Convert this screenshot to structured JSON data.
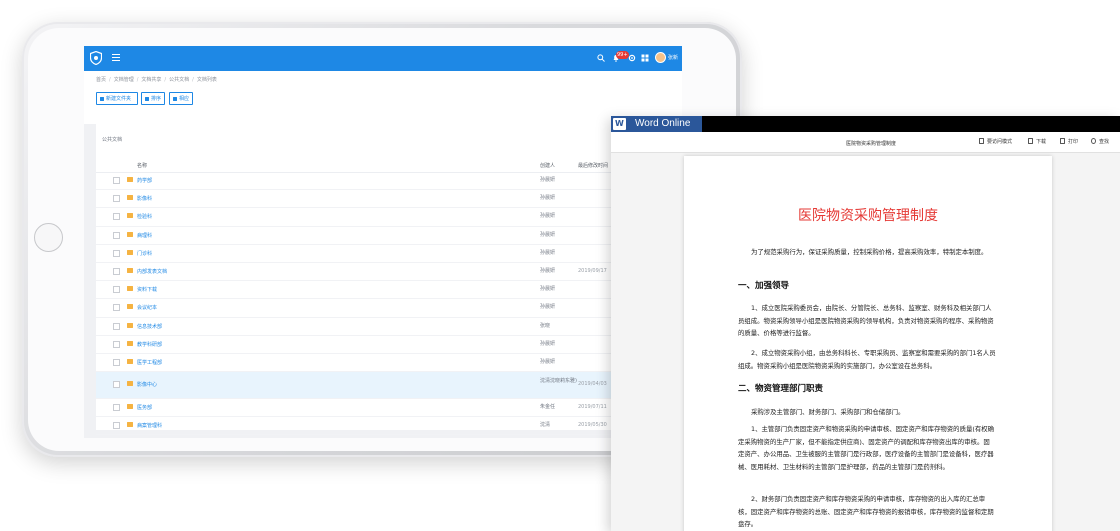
{
  "tablet_app": {
    "header": {
      "badge": "99+",
      "user_name": "张新"
    },
    "breadcrumb": [
      "首页",
      "文档管理",
      "文档共享",
      "公共文档",
      "文档列表"
    ],
    "toolbar": {
      "new_folder": "新建文件夹",
      "sort": "排序",
      "manage": "相应"
    },
    "panel": {
      "title": "公共文档",
      "columns": {
        "name": "名称",
        "creator": "创建人",
        "modified": "最后修改时间"
      },
      "rows": [
        {
          "name": "药学部",
          "creator": "孙晨妍",
          "date": ""
        },
        {
          "name": "影像科",
          "creator": "孙晨妍",
          "date": ""
        },
        {
          "name": "检验科",
          "creator": "孙晨妍",
          "date": ""
        },
        {
          "name": "病理科",
          "creator": "孙晨妍",
          "date": ""
        },
        {
          "name": "门诊科",
          "creator": "孙晨妍",
          "date": ""
        },
        {
          "name": "内部发表文档",
          "creator": "孙晨妍",
          "date": "2019/09/17"
        },
        {
          "name": "资料下载",
          "creator": "孙晨妍",
          "date": ""
        },
        {
          "name": "会议纪本",
          "creator": "孙晨妍",
          "date": ""
        },
        {
          "name": "信息技术部",
          "creator": "张晓",
          "date": ""
        },
        {
          "name": "教学科研部",
          "creator": "孙晨妍",
          "date": ""
        },
        {
          "name": "医学工程部",
          "creator": "孙晨妍",
          "date": ""
        },
        {
          "name": "影像中心",
          "creator": "沈清沈晓莉东雅)",
          "date": "2019/04/03",
          "highlight": true
        },
        {
          "name": "医务部",
          "creator": "朱金任",
          "date": "2019/07/11"
        },
        {
          "name": "病案管理科",
          "creator": "沈清",
          "date": "2019/05/30"
        }
      ]
    }
  },
  "word_online": {
    "app_title": "Word Online",
    "doc_name": "医院物资采购管理制度",
    "actions": {
      "edit": "要访问模式",
      "download": "下载",
      "print": "打印",
      "find": "查找"
    },
    "document": {
      "title": "医院物资采购管理制度",
      "intro": "为了规范采购行为，保证采购质量，控制采购价格，提高采购效率，特制定本制度。",
      "section1": "一、加强领导",
      "p1": "1、成立医院采购委员会，由院长、分管院长、总务科、监察室、财务科及相关部门人员组成。物资采购领导小组是医院物资采购的领导机构，负责对物资采购的程序、采购物资的质量、价格等进行监督。",
      "p2": "2、成立物资采购小组，由总务科科长、专职采购员、监察室和需要采购的部门1名人员组成。物资采购小组是医院物资采购的实施部门，办公室设在总务科。",
      "section2": "二、物资管理部门职责",
      "p3": "采购涉及主管部门、财务部门、采购部门和仓储部门。",
      "p4": "1、主管部门负责固定资产和物资采购的申请审核、固定资产和库存物资的质量(有权确定采购物资的生产厂家，但不能指定供应商)、固定资产的调配和库存物资出库的审核。固定资产、办公用品、卫生被服的主管部门是行政部，医疗设备的主管部门是设备科，医疗器械、医用耗材、卫生材料的主管部门是护理部，药品的主管部门是药剂科。",
      "p5": "2、财务部门负责固定资产和库存物资采购的申请审核，库存物资的出入库的汇总审核，固定资产和库存物资的总账、固定资产和库存物资的报销审核，库存物资的监督和定期盘存。"
    }
  }
}
